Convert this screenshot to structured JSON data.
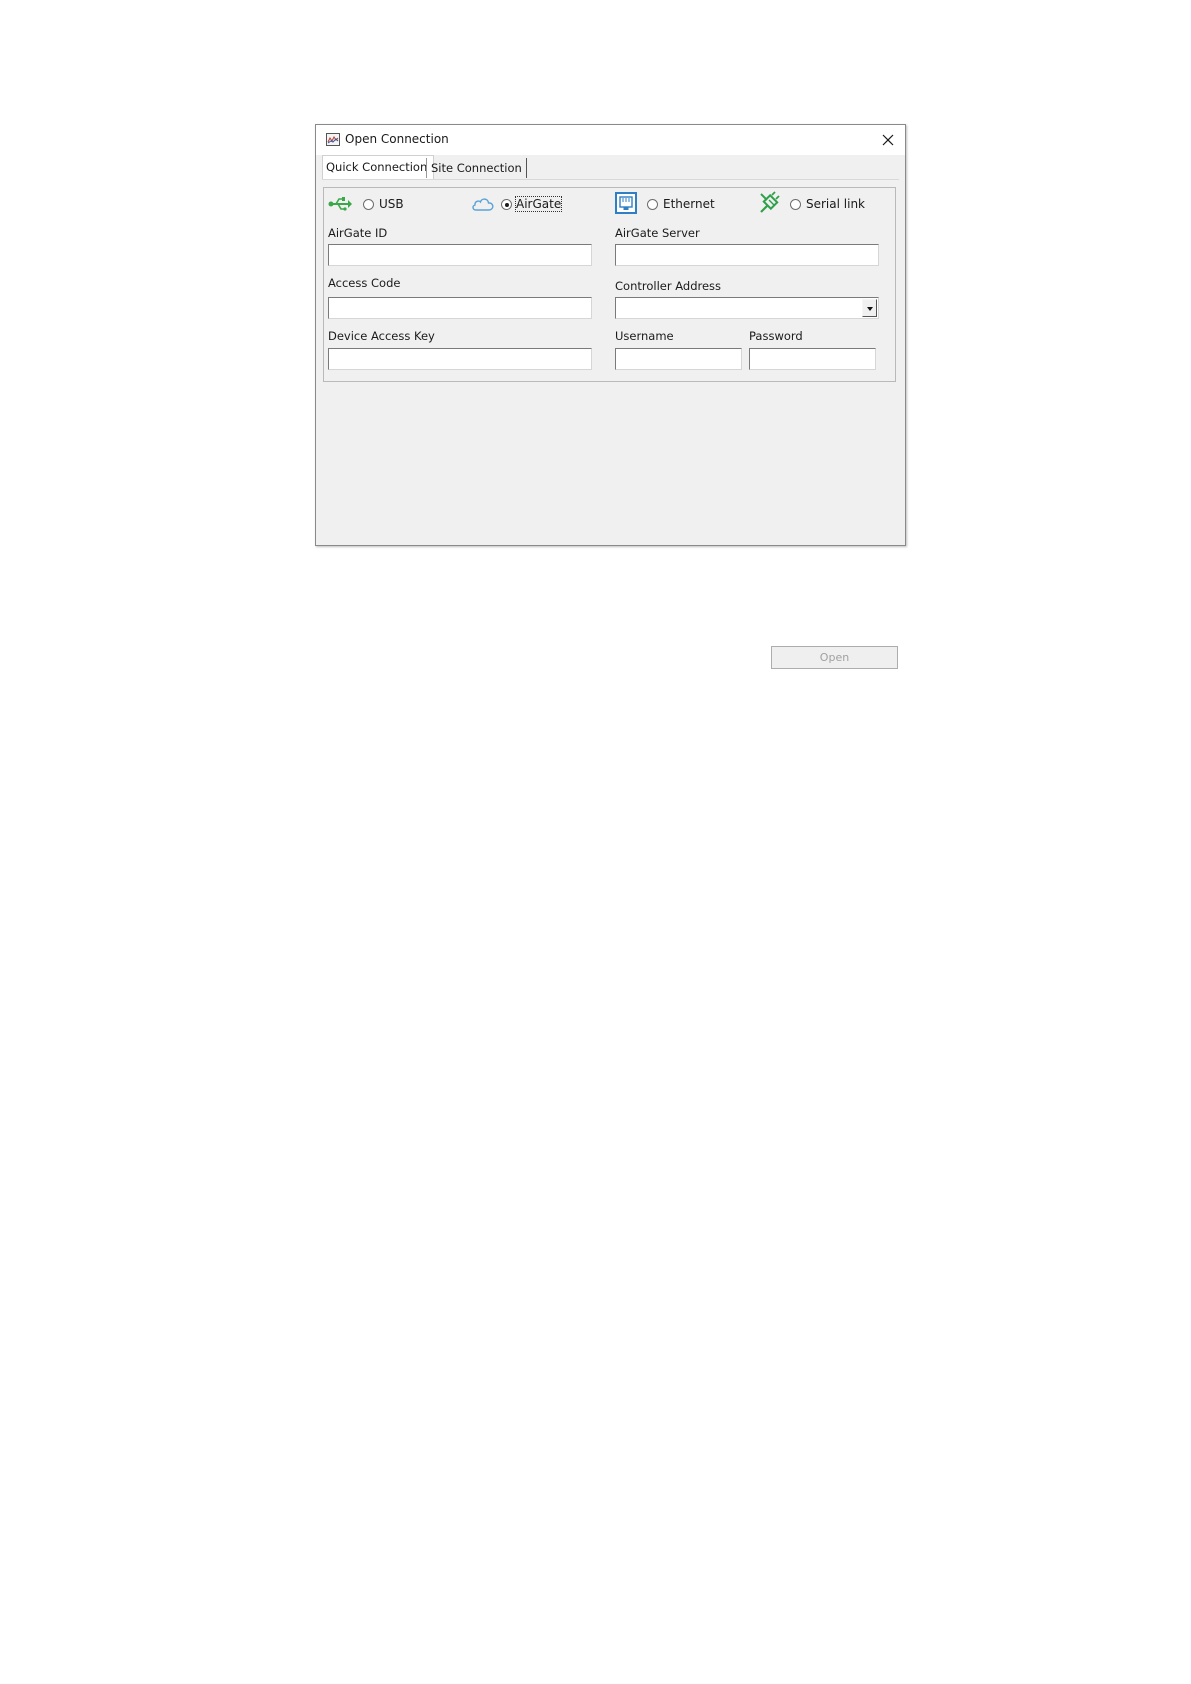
{
  "window": {
    "title": "Open Connection",
    "app_icon": "chart-window-icon",
    "close_icon": "close-icon"
  },
  "tabs": [
    {
      "label": "Quick Connection",
      "active": true
    },
    {
      "label": "Site Connection",
      "active": false
    }
  ],
  "connection_types": [
    {
      "label": "USB",
      "icon": "usb-icon",
      "selected": false
    },
    {
      "label": "AirGate",
      "icon": "cloud-icon",
      "selected": true
    },
    {
      "label": "Ethernet",
      "icon": "ethernet-port-icon",
      "selected": false
    },
    {
      "label": "Serial link",
      "icon": "serial-cable-icon",
      "selected": false
    }
  ],
  "fields": {
    "airgate_id": {
      "label": "AirGate ID",
      "value": ""
    },
    "airgate_server": {
      "label": "AirGate Server",
      "value": ""
    },
    "access_code": {
      "label": "Access Code",
      "value": ""
    },
    "controller_address": {
      "label": "Controller Address",
      "value": ""
    },
    "device_access_key": {
      "label": "Device Access Key",
      "value": ""
    },
    "username": {
      "label": "Username",
      "value": ""
    },
    "password": {
      "label": "Password",
      "value": ""
    }
  },
  "actions": {
    "open_label": "Open",
    "open_enabled": false
  },
  "colors": {
    "usb_green": "#3aa84a",
    "cloud_blue": "#5aa3d8",
    "ethernet_blue": "#2f7fc4",
    "serial_green": "#2fa04a"
  }
}
